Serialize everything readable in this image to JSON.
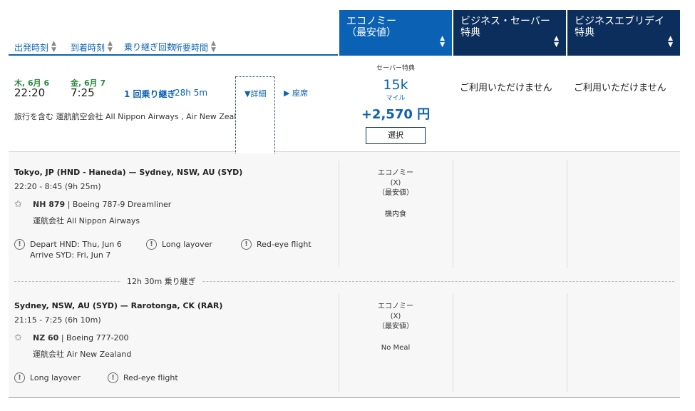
{
  "sort_header": {
    "departure": "出発時刻",
    "arrival": "到着時刻",
    "connections": "乗り継ぎ回数",
    "duration": "所要時間"
  },
  "cabins": [
    {
      "line1": "エコノミー",
      "line2": "（最安値）"
    },
    {
      "line1": "ビジネス・セーバー",
      "line2": "特典"
    },
    {
      "line1": "ビジネスエブリデイ",
      "line2": "特典"
    }
  ],
  "flight": {
    "depart_day": "木, 6月 6",
    "depart_time": "22:20",
    "arrive_day": "金, 6月 7",
    "arrive_time": "7:25",
    "stops": "1 回乗り継ぎ",
    "duration": "28h 5m",
    "details_link": "詳細",
    "seats_link": "座席",
    "operators": "旅行を含む 運航航空会社 All Nippon Airways , Air New Zealand"
  },
  "fare": {
    "label": "セーバー特典",
    "miles": "15k",
    "miles_unit": "マイル",
    "fee": "+2,570 円",
    "select_label": "選択"
  },
  "unavailable": [
    "ご利用いただけません",
    "ご利用いただけません"
  ],
  "segments": [
    {
      "route": "Tokyo, JP (HND - Haneda) — Sydney, NSW, AU (SYD)",
      "times": "22:20 - 8:45 (9h 25m)",
      "flight_no": "NH 879",
      "aircraft": "| Boeing 787-9 Dreamliner",
      "operator": "運航会社 All Nippon Airways",
      "warnings": [
        "Depart HND: Thu, Jun 6\nArrive SYD: Fri, Jun 7",
        "Long layover",
        "Red-eye flight"
      ],
      "cabin": {
        "name": "エコノミー",
        "code": "(X)",
        "note": "（最安値）",
        "meal": "機内食"
      }
    },
    {
      "route": "Sydney, NSW, AU (SYD) — Rarotonga, CK (RAR)",
      "times": "21:15 - 7:25 (6h 10m)",
      "flight_no": "NZ 60",
      "aircraft": "| Boeing 777-200",
      "operator": "運航会社 Air New Zealand",
      "warnings": [
        "Long layover",
        "Red-eye flight"
      ],
      "cabin": {
        "name": "エコノミー",
        "code": "(X)",
        "note": "（最安値）",
        "meal": "No Meal"
      }
    }
  ],
  "layover": "12h 30m 乗り継ぎ",
  "icons": {
    "sort": "sort-arrows-icon",
    "star_alliance": "star-icon",
    "warning": "exclamation-circle-icon",
    "caret": "caret-icon"
  },
  "colors": {
    "link_blue": "#0b62b5",
    "navy": "#0c2e5c",
    "day_green": "#2b8a3e"
  }
}
